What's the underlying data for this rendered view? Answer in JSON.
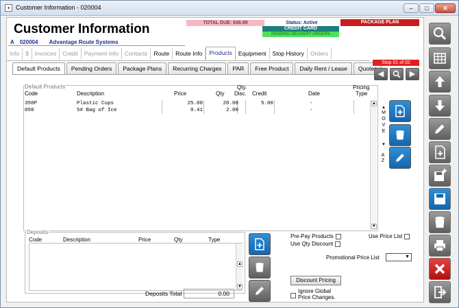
{
  "window": {
    "title": "Customer Information - 020004",
    "controls": {
      "minimize": "–",
      "maximize": "□",
      "close": "✕"
    }
  },
  "header": {
    "title": "Customer Information",
    "prefix": "A",
    "account": "020004",
    "company": "Advantage Route Systems",
    "total_due": "TOTAL DUE: 636.99",
    "status": "Status: Active",
    "credit_card": "CREDIT CARD",
    "pending_orders": "PENDING DELIVERY ORDERS",
    "package_plan": "PACKAGE PLAN",
    "colors": {
      "pink": "#f6b8c2",
      "teal": "#1b7f7f",
      "green": "#4fe15a",
      "red": "#c91d1d",
      "blue": "#1b2d8f"
    }
  },
  "tabs_top": [
    "Info",
    "$",
    "Invoices",
    "Credit",
    "Payment Info",
    "Contacts",
    "Route",
    "Route Info",
    "Products",
    "Equipment",
    "Stop History",
    "Orders"
  ],
  "tabs_top_enabled": [
    false,
    false,
    false,
    false,
    false,
    false,
    true,
    true,
    true,
    true,
    true,
    false
  ],
  "tabs_sub": [
    "Default Products",
    "Pending Orders",
    "Package Plans",
    "Recurring Charges",
    "PAR",
    "Free Product",
    "Daily Rent / Lease",
    "Quotes"
  ],
  "stop_indicator": "Stop 01 of 02",
  "products": {
    "legend": "Default Products",
    "columns": {
      "code": "Code",
      "description": "Description",
      "price": "Price",
      "qty": "Qty",
      "qty_disc_top": "Qty.",
      "qty_disc_bottom": "Disc.",
      "credit": "Credit",
      "date": "Date",
      "pricing_type_top": "Pricing",
      "pricing_type_bottom": "Type"
    },
    "rows": [
      {
        "code": "350P",
        "description": "Plastic Cups",
        "price": "25.00",
        "qty": "20.00",
        "credit": "5.00",
        "date": "-"
      },
      {
        "code": "050",
        "description": "5# Bag of Ice",
        "price": "0.41",
        "qty": "2.00",
        "credit": "",
        "date": "-"
      }
    ],
    "move_label": "MOVE",
    "az_label": "AZ"
  },
  "deposits": {
    "legend": "Deposits",
    "columns": {
      "code": "Code",
      "description": "Description",
      "price": "Price",
      "qty": "Qty",
      "type": "Type"
    },
    "total_label": "Deposits Total",
    "total_value": "0.00"
  },
  "options": {
    "prepay_label": "Pre-Pay Products",
    "use_qty_discount_label": "Use Qty Discount",
    "use_price_list_label": "Use Price List",
    "promo_label": "Promotional Price List",
    "promo_value": "",
    "discount_pricing_button": "Discount Pricing",
    "ignore_global_line1": "Ignore Global",
    "ignore_global_line2": "Price Changes."
  },
  "sidebar_icons": [
    "search-icon",
    "grid-icon",
    "arrow-up-icon",
    "arrow-down-icon",
    "pencil-icon",
    "new-document-icon",
    "save-new-icon",
    "save-icon",
    "trash-icon",
    "print-icon",
    "close-icon",
    "exit-icon"
  ]
}
